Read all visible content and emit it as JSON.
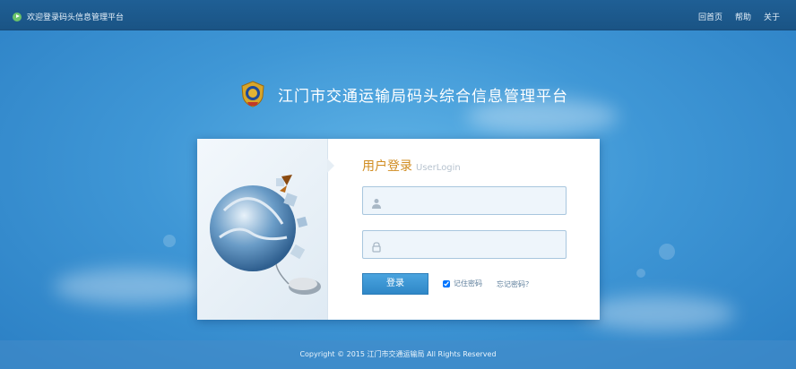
{
  "topbar": {
    "welcome_text": "欢迎登录码头信息管理平台",
    "nav": [
      {
        "label": "回首页"
      },
      {
        "label": "帮助"
      },
      {
        "label": "关于"
      }
    ]
  },
  "header": {
    "title": "江门市交通运输局码头综合信息管理平台",
    "emblem_icon": "police-emblem-icon"
  },
  "login": {
    "heading_cn": "用户登录",
    "heading_en": "UserLogin",
    "username_icon": "user-icon",
    "password_icon": "lock-icon",
    "username_value": "",
    "password_value": "",
    "submit_label": "登录",
    "remember_label": "记住密码",
    "remember_checked": true,
    "forgot_label": "忘记密码？"
  },
  "footer": {
    "copyright": "Copyright © 2015 江门市交通运输局 All Rights Reserved"
  },
  "colors": {
    "background": "#3f97d6",
    "topbar": "#1f5f95",
    "accent_orange": "#d08c20",
    "button_blue": "#2f87c7"
  }
}
